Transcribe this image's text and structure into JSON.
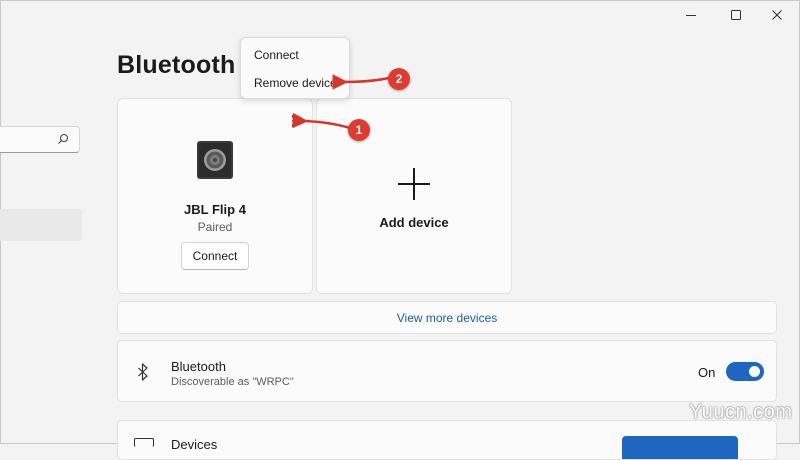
{
  "window": {
    "controls": {
      "minimize_icon": "minimize-icon",
      "maximize_icon": "maximize-icon",
      "close_icon": "close-icon"
    }
  },
  "sidebar": {
    "search_icon": "search-icon"
  },
  "header": {
    "title": "Bluetooth & devices"
  },
  "device_cards": [
    {
      "name": "JBL Flip 4",
      "status": "Paired",
      "action_label": "Connect",
      "icon": "speaker-icon",
      "more_icon": "more-options-icon"
    },
    {
      "name": "Add device",
      "icon": "plus-icon"
    }
  ],
  "view_more_label": "View more devices",
  "bluetooth": {
    "title": "Bluetooth",
    "subtitle": "Discoverable as \"WRPC\"",
    "state_label": "On",
    "enabled": true,
    "icon": "bluetooth-icon"
  },
  "devices_row": {
    "title": "Devices"
  },
  "context_menu": {
    "items": [
      "Connect",
      "Remove device"
    ]
  },
  "annotations": {
    "badges": [
      "1",
      "2"
    ],
    "color": "#e03b2e"
  },
  "watermark": "Yuucn.com",
  "colors": {
    "accent": "#1e66c0",
    "link": "#1d5fa8",
    "background": "#f3f3f3"
  }
}
